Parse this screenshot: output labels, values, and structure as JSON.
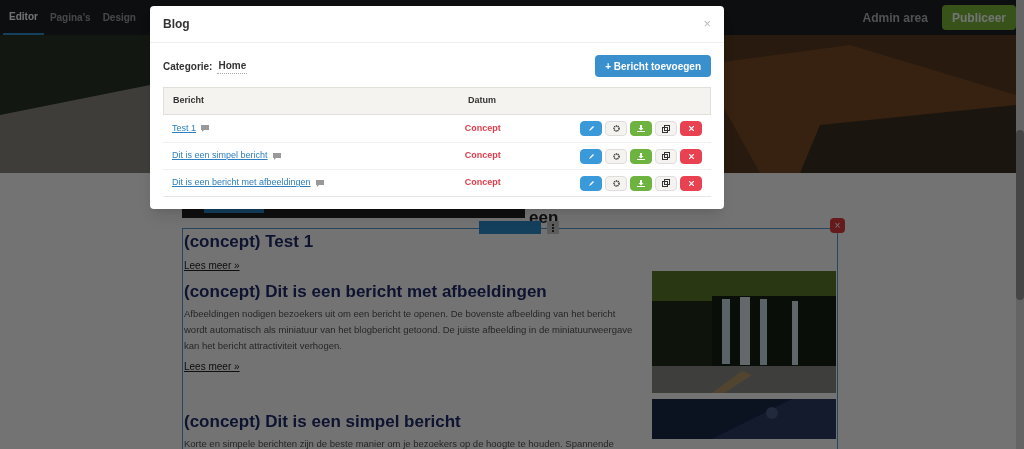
{
  "nav": {
    "tabs": [
      {
        "label": "Editor",
        "selected": true
      },
      {
        "label": "Pagina's",
        "selected": false
      },
      {
        "label": "Design",
        "selected": false
      }
    ],
    "admin": "Admin area",
    "publish": "Publiceer"
  },
  "page": {
    "heading_fragment": "een",
    "block_close": "×",
    "posts": [
      {
        "kind": "text",
        "title": "(concept) Test 1",
        "more": "Lees meer »"
      },
      {
        "title": "(concept) Dit is een bericht met afbeeldingen",
        "body": "Afbeeldingen nodigen bezoekers uit om een bericht te openen. De bovenste afbeelding van het bericht wordt automatisch als miniatuur van het blogbericht getoond. De juiste afbeelding in de miniatuurweergave kan het bericht attractiviteit verhogen.",
        "more": "Lees meer »"
      },
      {
        "title": "(concept) Dit is een simpel bericht",
        "body": "Korte en simpele berichten zijn de beste manier om je bezoekers op de hoogte te houden. Spannende"
      }
    ]
  },
  "modal": {
    "title": "Blog",
    "close": "×",
    "category_label": "Categorie:",
    "category": "Home",
    "add_button": "+ Bericht toevoegen",
    "columns": [
      "Bericht",
      "Datum"
    ],
    "rows": [
      {
        "title": "Test 1",
        "status": "Concept"
      },
      {
        "title": "Dit is een simpel bericht",
        "status": "Concept"
      },
      {
        "title": "Dit is een bericht met afbeeldingen",
        "status": "Concept"
      }
    ]
  }
}
